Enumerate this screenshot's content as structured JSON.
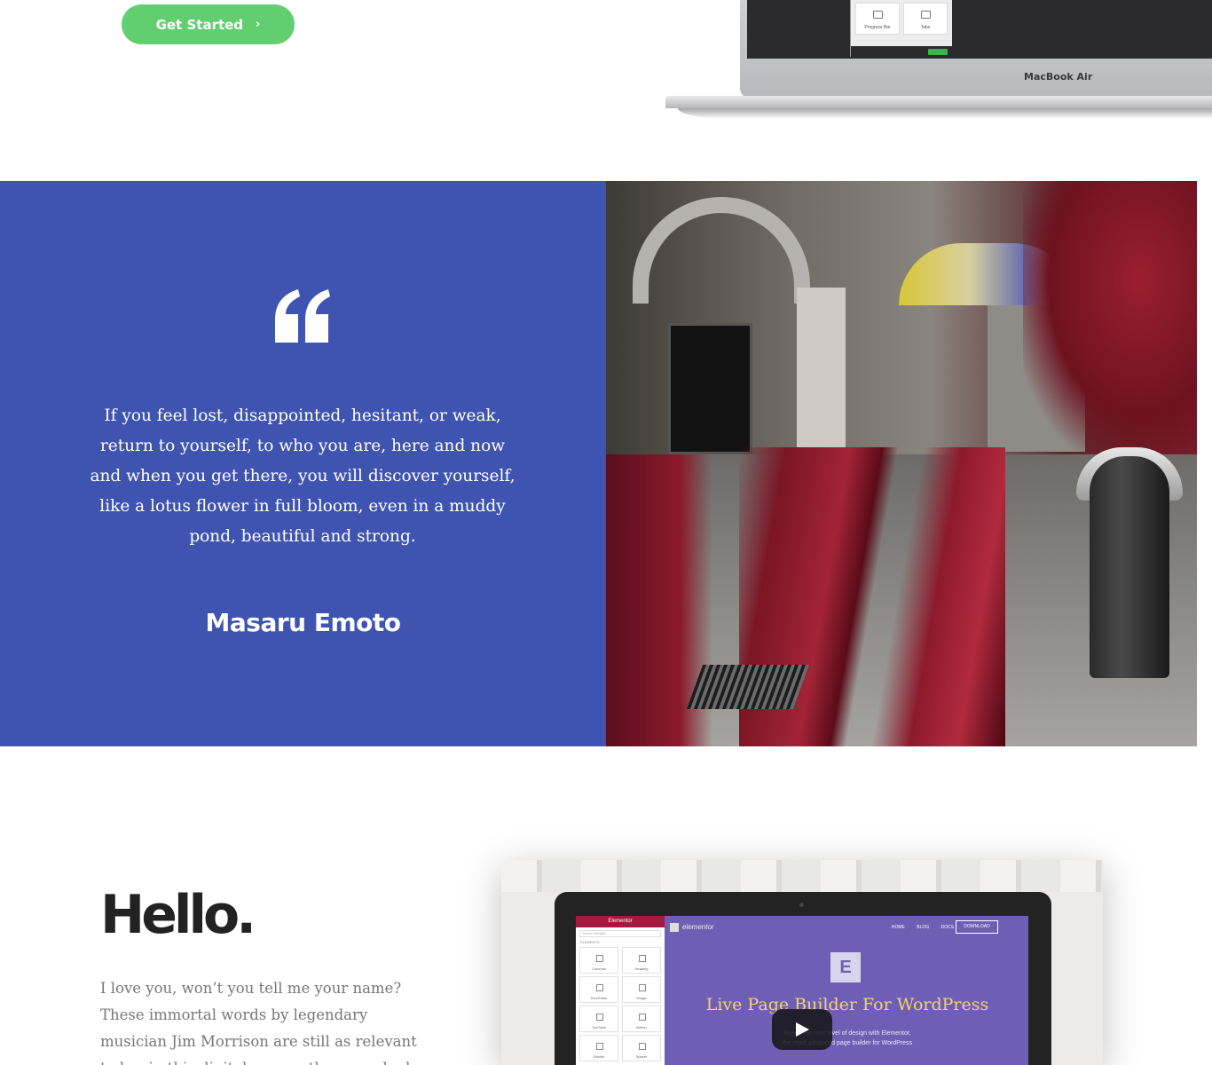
{
  "hero": {
    "cta_label": "Get Started",
    "cta_icon": "chevron-right-icon",
    "accent_color": "#61ce70",
    "laptop": {
      "brand": "MacBook Air",
      "tile_1_label": "Progress Bar",
      "tile_2_label": "Tabs",
      "save_label": "SAVE"
    }
  },
  "testimonial": {
    "background_color": "#3f54b0",
    "icon": "quote-left-icon",
    "text": "If you feel lost, disappointed, hesitant, or weak, return to yourself, to who you are, here and now and when you get there, you will discover yourself, like a lotus flower in full bloom, even in a muddy pond, beautiful and strong.",
    "author": "Masaru Emoto"
  },
  "intro": {
    "title": "Hello.",
    "body": "I love you, won’t you tell me your name? These immortal words by legendary musician Jim Morrison are still as relevant today, in this digital age, as they ever had ..."
  },
  "video": {
    "sidebar_title": "Elementor",
    "search_placeholder": "Search Widget...",
    "elements_label": "ELEMENTS",
    "widgets": [
      "Columns",
      "Heading",
      "Text Editor",
      "Image",
      "YouTube",
      "Button",
      "Divider",
      "Spacer"
    ],
    "site_logo_text": "elementor",
    "nav_links": [
      "HOME",
      "BLOG",
      "DOCS"
    ],
    "download_label": "DOWNLOAD",
    "headline": "Live Page Builder For WordPress",
    "subline_1": "Reach the next level of design with Elementor,",
    "subline_2": "the most advanced page builder for WordPress",
    "play_icon": "play-icon"
  }
}
